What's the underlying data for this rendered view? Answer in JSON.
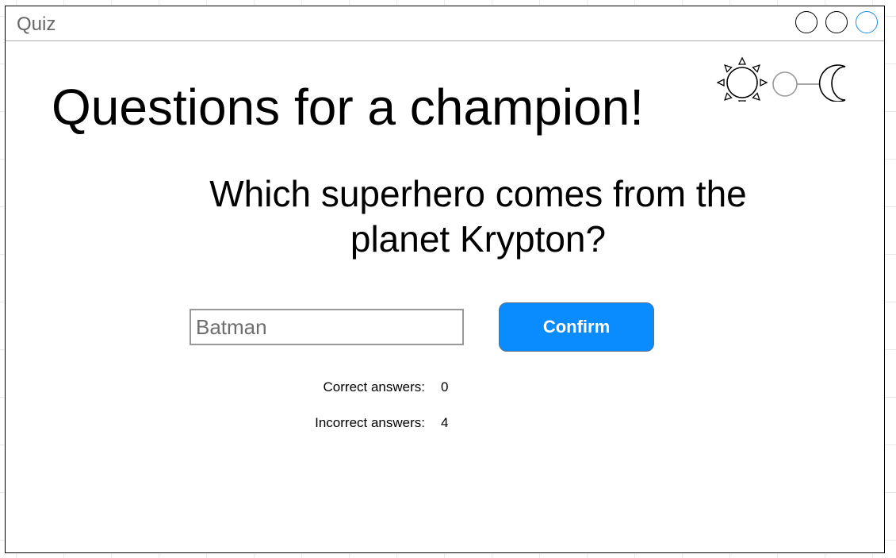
{
  "window": {
    "title": "Quiz"
  },
  "header": {
    "title": "Questions for a champion!"
  },
  "quiz": {
    "question": "Which superhero comes from the planet Krypton?",
    "answer_value": "Batman",
    "confirm_label": "Confirm"
  },
  "stats": {
    "correct_label": "Correct answers:",
    "correct_value": "0",
    "incorrect_label": "Incorrect answers:",
    "incorrect_value": "4"
  },
  "theme_toggle": {
    "left_icon": "sun-icon",
    "right_icon": "moon-icon",
    "state": "light"
  },
  "colors": {
    "accent": "#0a8cff",
    "active_window_button": "#1a8fe3"
  }
}
